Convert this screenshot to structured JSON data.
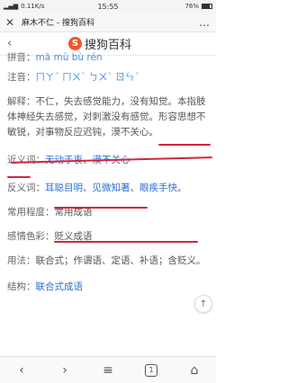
{
  "status": {
    "signal": "▂▄▆",
    "net": "0.11K/s",
    "time": "15:55",
    "battery": "76%"
  },
  "title_bar": {
    "close_glyph": "✕",
    "title": "麻木不仁 - 搜狗百科",
    "more_glyph": "…"
  },
  "site_bar": {
    "back_glyph": "‹",
    "logo_letter": "S",
    "logo_text": "搜狗百科"
  },
  "entry": {
    "pinyin_label": "拼音：",
    "pinyin": "mā mù bù rén",
    "zhuyin_label": "注音：",
    "zhuyin": "ㄇㄚˊ ㄇㄨˋ ㄅㄨˋ ㄖㄣˊ",
    "explain_label": "解释：",
    "explain": "不仁，失去感觉能力，没有知觉。本指肢体神经失去感觉，对刺激没有感觉。形容思想不敏锐，对事物反应迟钝，漠不关心。",
    "synonyms_label": "近义词：",
    "synonyms": [
      "无动于衷",
      "漠不关心"
    ],
    "antonyms_label": "反义词：",
    "antonyms": [
      "耳聪目明",
      "见微知著",
      "眼疾手快"
    ],
    "usage_freq_label": "常用程度：",
    "usage_freq": "常用成语",
    "emotion_label": "感情色彩：",
    "emotion": "贬义成语",
    "usage_label": "用法：",
    "usage": "联合式；作谓语、定语、补语；含贬义。",
    "structure_label": "结构：",
    "structure": "联合式成语"
  },
  "side_button": {
    "glyph": "↑"
  },
  "bottom_nav": {
    "back": "‹",
    "forward": "›",
    "menu": "≡",
    "tabs": "1",
    "home": "⌂"
  },
  "colors": {
    "link": "#2a6fd6",
    "underline": "#d4253a",
    "logo": "#f0562a"
  }
}
